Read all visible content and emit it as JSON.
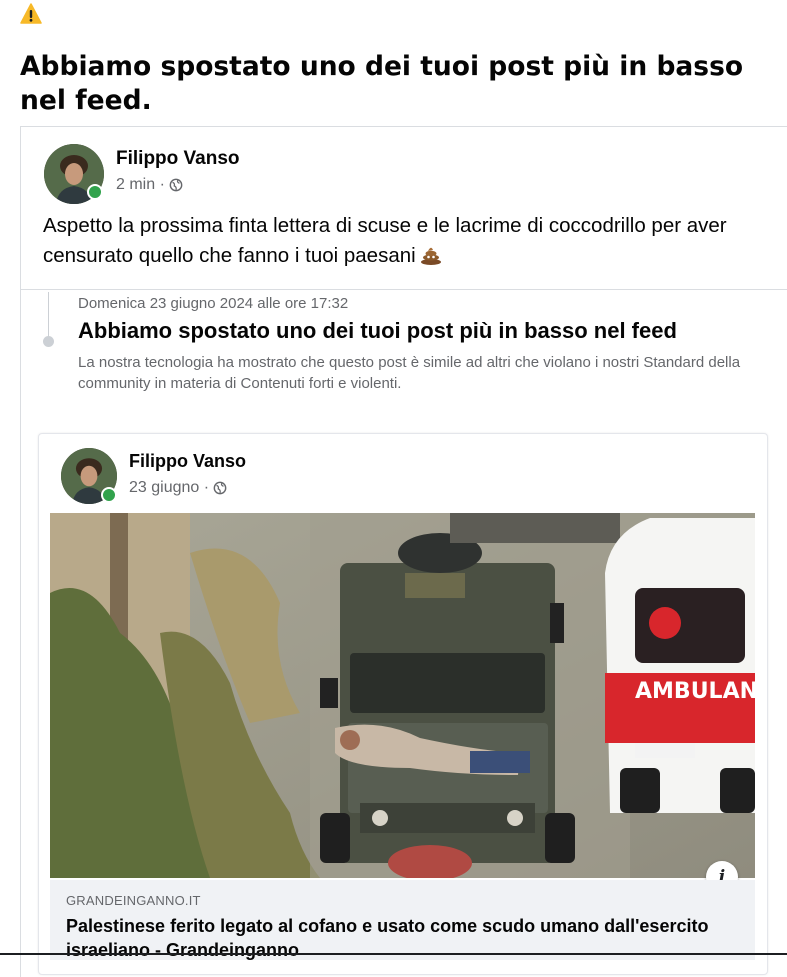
{
  "banner": {
    "icon": "warning-triangle-icon",
    "headline": "Abbiamo spostato uno dei tuoi post più in basso nel feed."
  },
  "post": {
    "author": "Filippo Vanso",
    "time": "2 min ·",
    "privacy_icon": "globe-icon",
    "text": "Aspetto la prossima finta lettera di scuse e le lacrime di coccodrillo per aver censurato quello che fanno i tuoi paesani",
    "emoji": "poop-emoji"
  },
  "notice": {
    "date": "Domenica 23 giugno 2024 alle ore 17:32",
    "title": "Abbiamo spostato uno dei tuoi post più in basso nel feed",
    "body": "La nostra tecnologia ha mostrato che questo post è simile ad altri che violano i nostri Standard della community in materia di Contenuti forti e violenti."
  },
  "shared_post": {
    "author": "Filippo Vanso",
    "time": "23 giugno ·",
    "privacy_icon": "globe-icon",
    "link": {
      "domain": "GRANDEINGANNO.IT",
      "title": "Palestinese ferito legato al cofano e usato come scudo umano dall'esercito israeliano - Grandeinganno"
    },
    "info_label": "i"
  },
  "colors": {
    "online": "#31a24c",
    "secondary_text": "#65676b",
    "ambulance_red": "#d8262c"
  }
}
